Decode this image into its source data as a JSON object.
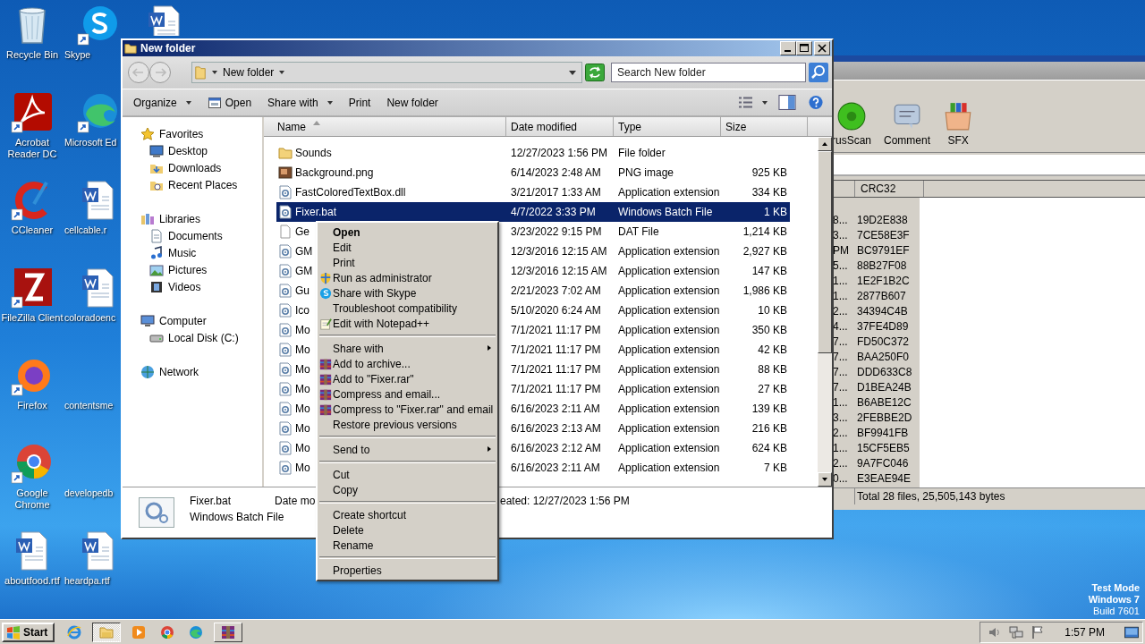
{
  "desktop_icons": [
    {
      "label": "Recycle Bin",
      "kind": "recycle",
      "shortcut": false
    },
    {
      "label": "Acrobat Reader DC",
      "kind": "acrobat",
      "shortcut": true
    },
    {
      "label": "CCleaner",
      "kind": "ccleaner",
      "shortcut": true
    },
    {
      "label": "FileZilla Client",
      "kind": "filezilla",
      "shortcut": true
    },
    {
      "label": "Firefox",
      "kind": "firefox",
      "shortcut": true
    },
    {
      "label": "Google Chrome",
      "kind": "chrome",
      "shortcut": true
    },
    {
      "label": "aboutfood.rtf",
      "kind": "word",
      "shortcut": false
    },
    {
      "label": "Skype",
      "kind": "skype",
      "shortcut": true
    },
    {
      "label": "Microsoft Ed",
      "kind": "edge",
      "shortcut": true
    },
    {
      "label": "cellcable.r",
      "kind": "word",
      "shortcut": false
    },
    {
      "label": "coloradoenc",
      "kind": "word",
      "shortcut": false
    },
    {
      "label": "contentsme",
      "kind": "none"
    },
    {
      "label": "developedb",
      "kind": "none"
    },
    {
      "label": "heardpa.rtf",
      "kind": "word",
      "shortcut": false
    },
    {
      "kind": "word",
      "shortcut": false
    }
  ],
  "background_window": {
    "toolbar": [
      {
        "label": "rusScan",
        "kind": "scan"
      },
      {
        "label": "Comment",
        "kind": "comment"
      },
      {
        "label": "SFX",
        "kind": "sfx"
      }
    ],
    "columns": [
      "CRC32"
    ],
    "rows": [
      {
        "column_1": "8...",
        "crc32": "19D2E838"
      },
      {
        "column_1": "3...",
        "crc32": "7CE58E3F"
      },
      {
        "column_1": "PM",
        "crc32": "BC9791EF"
      },
      {
        "column_1": "5...",
        "crc32": "88B27F08"
      },
      {
        "column_1": "1...",
        "crc32": "1E2F1B2C"
      },
      {
        "column_1": "1...",
        "crc32": "2877B607"
      },
      {
        "column_1": "2...",
        "crc32": "34394C4B"
      },
      {
        "column_1": "4...",
        "crc32": "37FE4D89"
      },
      {
        "column_1": "7...",
        "crc32": "FD50C372"
      },
      {
        "column_1": "7...",
        "crc32": "BAA250F0"
      },
      {
        "column_1": "7...",
        "crc32": "DDD633C8"
      },
      {
        "column_1": "7...",
        "crc32": "D1BEA24B"
      },
      {
        "column_1": "1...",
        "crc32": "B6ABE12C"
      },
      {
        "column_1": "3...",
        "crc32": "2FEBBE2D"
      },
      {
        "column_1": "2...",
        "crc32": "BF9941FB"
      },
      {
        "column_1": "1...",
        "crc32": "15CF5EB5"
      },
      {
        "column_1": "2...",
        "crc32": "9A7FC046"
      },
      {
        "column_1": "0...",
        "crc32": "E3EAE94E"
      }
    ],
    "status": "Total 28 files, 25,505,143 bytes"
  },
  "explorer": {
    "title": "New folder",
    "address": "New folder",
    "search": {
      "placeholder": "Search New folder"
    },
    "toolbar": [
      {
        "label": "Organize",
        "dropdown": true
      },
      {
        "label": "Open",
        "dropdown": false
      },
      {
        "label": "Share with",
        "dropdown": true
      },
      {
        "label": "Print",
        "dropdown": false
      },
      {
        "label": "New folder",
        "dropdown": false
      }
    ],
    "nav": [
      {
        "label": "Favorites",
        "kind": "star",
        "children": [
          {
            "label": "Desktop",
            "kind": "desktop"
          },
          {
            "label": "Downloads",
            "kind": "downloads"
          },
          {
            "label": "Recent Places",
            "kind": "recent"
          }
        ]
      },
      {
        "label": "Libraries",
        "kind": "libraries",
        "children": [
          {
            "label": "Documents",
            "kind": "documents"
          },
          {
            "label": "Music",
            "kind": "music"
          },
          {
            "label": "Pictures",
            "kind": "pictures"
          },
          {
            "label": "Videos",
            "kind": "videos"
          }
        ]
      },
      {
        "label": "Computer",
        "kind": "computer",
        "children": [
          {
            "label": "Local Disk (C:)",
            "kind": "disk"
          }
        ]
      },
      {
        "label": "Network",
        "kind": "network"
      }
    ],
    "columns": [
      "Name",
      "Date modified",
      "Type",
      "Size"
    ],
    "rows": [
      {
        "name": "Sounds",
        "kind": "folder",
        "date": "12/27/2023 1:56 PM",
        "type": "File folder",
        "selected": false
      },
      {
        "name": "Background.png",
        "kind": "image",
        "date": "6/14/2023 2:48 AM",
        "type": "PNG image",
        "size": "925 KB",
        "selected": false
      },
      {
        "name": "FastColoredTextBox.dll",
        "kind": "gear",
        "date": "3/21/2017 1:33 AM",
        "type": "Application extension",
        "size": "334 KB",
        "selected": false
      },
      {
        "name": "Fixer.bat",
        "kind": "gear",
        "date": "4/7/2022 3:33 PM",
        "type": "Windows Batch File",
        "size": "1 KB",
        "selected": true
      },
      {
        "name": "Ge",
        "kind": "blank",
        "date": "3/23/2022 9:15 PM",
        "type": "DAT File",
        "size": "1,214 KB",
        "selected": false
      },
      {
        "name": "GM",
        "kind": "gear",
        "date": "12/3/2016 12:15 AM",
        "type": "Application extension",
        "size": "2,927 KB",
        "selected": false
      },
      {
        "name": "GM",
        "kind": "gear",
        "date": "12/3/2016 12:15 AM",
        "type": "Application extension",
        "size": "147 KB",
        "selected": false
      },
      {
        "name": "Gu",
        "kind": "gear",
        "date": "2/21/2023 7:02 AM",
        "type": "Application extension",
        "size": "1,986 KB",
        "selected": false
      },
      {
        "name": "Ico",
        "kind": "gear",
        "date": "5/10/2020 6:24 AM",
        "type": "Application extension",
        "size": "10 KB",
        "selected": false
      },
      {
        "name": "Mo",
        "kind": "gear",
        "date": "7/1/2021 11:17 PM",
        "type": "Application extension",
        "size": "350 KB",
        "selected": false
      },
      {
        "name": "Mo",
        "kind": "gear",
        "date": "7/1/2021 11:17 PM",
        "type": "Application extension",
        "size": "42 KB",
        "selected": false
      },
      {
        "name": "Mo",
        "kind": "gear",
        "date": "7/1/2021 11:17 PM",
        "type": "Application extension",
        "size": "88 KB",
        "selected": false
      },
      {
        "name": "Mo",
        "kind": "gear",
        "date": "7/1/2021 11:17 PM",
        "type": "Application extension",
        "size": "27 KB",
        "selected": false
      },
      {
        "name": "Mo",
        "kind": "gear",
        "date": "6/16/2023 2:11 AM",
        "type": "Application extension",
        "size": "139 KB",
        "selected": false
      },
      {
        "name": "Mo",
        "kind": "gear",
        "date": "6/16/2023 2:13 AM",
        "type": "Application extension",
        "size": "216 KB",
        "selected": false
      },
      {
        "name": "Mo",
        "kind": "gear",
        "date": "6/16/2023 2:12 AM",
        "type": "Application extension",
        "size": "624 KB",
        "selected": false
      },
      {
        "name": "Mo",
        "kind": "gear",
        "date": "6/16/2023 2:11 AM",
        "type": "Application extension",
        "size": "7 KB",
        "selected": false
      }
    ],
    "details": {
      "name": "Fixer.bat",
      "type": "Windows Batch File",
      "field_1": "Date mo",
      "field_2": "eated: 12/27/2023 1:56 PM"
    }
  },
  "context_menu": [
    {
      "kind": "item",
      "label": "Open",
      "default": true
    },
    {
      "kind": "item",
      "label": "Edit",
      "default": false
    },
    {
      "kind": "item",
      "label": "Print",
      "default": false
    },
    {
      "kind": "shield",
      "label": "Run as administrator",
      "default": false
    },
    {
      "kind": "skype",
      "label": "Share with Skype",
      "default": false
    },
    {
      "kind": "item",
      "label": "Troubleshoot compatibility",
      "default": false
    },
    {
      "kind": "notepad",
      "label": "Edit with Notepad++",
      "default": false
    },
    {
      "kind": "separator"
    },
    {
      "kind": "item",
      "label": "Share with",
      "default": false,
      "submenu": true
    },
    {
      "kind": "archive",
      "label": "Add to archive...",
      "default": false
    },
    {
      "kind": "archive",
      "label": "Add to \"Fixer.rar\"",
      "default": false
    },
    {
      "kind": "archive",
      "label": "Compress and email...",
      "default": false
    },
    {
      "kind": "archive",
      "label": "Compress to \"Fixer.rar\" and email",
      "default": false
    },
    {
      "kind": "item",
      "label": "Restore previous versions",
      "default": false
    },
    {
      "kind": "separator"
    },
    {
      "kind": "item",
      "label": "Send to",
      "default": false,
      "submenu": true
    },
    {
      "kind": "separator"
    },
    {
      "kind": "item",
      "label": "Cut",
      "default": false
    },
    {
      "kind": "item",
      "label": "Copy",
      "default": false
    },
    {
      "kind": "separator"
    },
    {
      "kind": "item",
      "label": "Create shortcut",
      "default": false
    },
    {
      "kind": "item",
      "label": "Delete",
      "default": false
    },
    {
      "kind": "item",
      "label": "Rename",
      "default": false
    },
    {
      "kind": "separator"
    },
    {
      "kind": "item",
      "label": "Properties",
      "default": false
    }
  ],
  "desktop_notice": [
    "Test Mode",
    "Windows 7",
    "Build 7601"
  ],
  "taskbar": {
    "start": "Start",
    "apps": [
      {
        "kind": "ie",
        "selected": false
      },
      {
        "kind": "explorer",
        "selected": true
      },
      {
        "kind": "media",
        "selected": false
      },
      {
        "kind": "chrome",
        "selected": false
      },
      {
        "kind": "edge",
        "selected": false
      },
      {
        "kind": "rar",
        "selected": false
      }
    ],
    "clock": "1:57 PM"
  }
}
